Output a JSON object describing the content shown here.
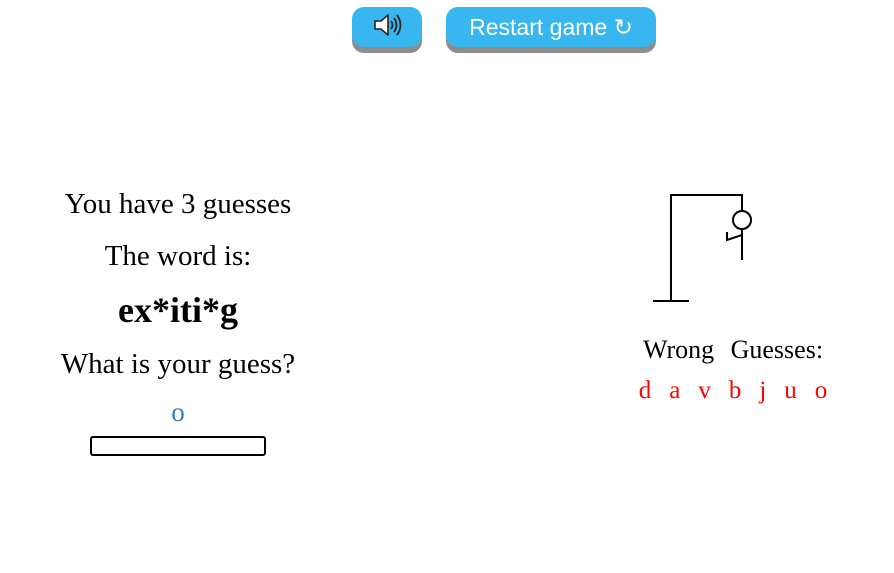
{
  "toolbar": {
    "sound_icon": "speaker-volume-icon",
    "restart_label": "Restart game ↻",
    "button_color": "#38b6f0"
  },
  "status": {
    "guesses_text": "You have 3 guesses",
    "word_prompt": "The word is:",
    "masked_word": "ex*iti*g",
    "guess_prompt": "What is your guess?",
    "current_guess": "o"
  },
  "input": {
    "value": ""
  },
  "wrong": {
    "label": "Wrong Guesses:",
    "letters": [
      "d",
      "a",
      "v",
      "b",
      "j",
      "u",
      "o"
    ],
    "color": "#ff0000"
  }
}
